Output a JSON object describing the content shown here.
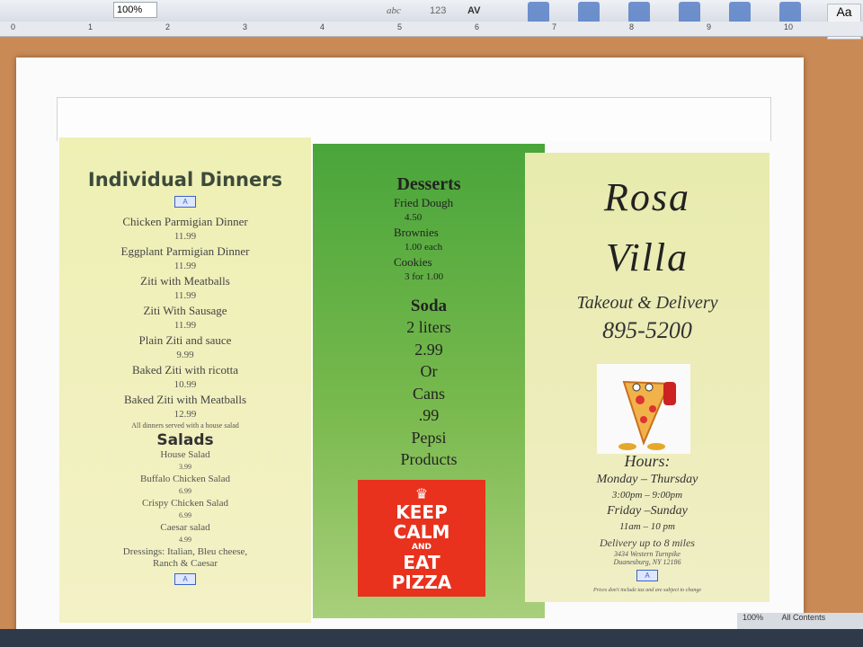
{
  "ribbon": {
    "zoom_value": "100%",
    "tools": [
      {
        "label": "Text Box",
        "icon": "text-box-icon"
      },
      {
        "label": "WordArt",
        "icon": "wordart-icon"
      },
      {
        "label": "Shape",
        "icon": "shape-icon"
      },
      {
        "label": "Picture",
        "icon": "picture-icon"
      },
      {
        "label": "Reorder",
        "icon": "reorder-icon"
      },
      {
        "label": "Group",
        "icon": "group-icon"
      }
    ],
    "theme_label": "Aa"
  },
  "ruler": {
    "ticks": [
      "0",
      "1",
      "2",
      "3",
      "4",
      "5",
      "6",
      "7",
      "8",
      "9",
      "10"
    ]
  },
  "left_panel": {
    "heading": "Individual Dinners",
    "dinners": [
      {
        "name": "Chicken Parmigian Dinner",
        "price": "11.99"
      },
      {
        "name": "Eggplant Parmigian Dinner",
        "price": "11.99"
      },
      {
        "name": "Ziti with Meatballs",
        "price": "11.99"
      },
      {
        "name": "Ziti With Sausage",
        "price": "11.99"
      },
      {
        "name": "Plain Ziti and sauce",
        "price": "9.99"
      },
      {
        "name": "Baked Ziti with ricotta",
        "price": "10.99"
      },
      {
        "name": "Baked Ziti with Meatballs",
        "price": "12.99"
      }
    ],
    "dinner_note": "All dinners served with a house salad",
    "salads_heading": "Salads",
    "salads": [
      {
        "name": "House Salad",
        "price": "3.99"
      },
      {
        "name": "Buffalo Chicken Salad",
        "price": "6.99"
      },
      {
        "name": "Crispy Chicken Salad",
        "price": "6.99"
      },
      {
        "name": "Caesar salad",
        "price": "4.99"
      }
    ],
    "dressings_line1": "Dressings: Italian, Bleu cheese,",
    "dressings_line2": "Ranch & Caesar"
  },
  "middle_panel": {
    "desserts_heading": "Desserts",
    "desserts": [
      {
        "name": "Fried Dough",
        "price": "4.50"
      },
      {
        "name": "Brownies",
        "price": "1.00 each"
      },
      {
        "name": "Cookies",
        "price": "3 for 1.00"
      }
    ],
    "soda_heading": "Soda",
    "soda_lines": [
      "2 liters",
      "2.99",
      "Or",
      "Cans",
      ".99",
      "Pepsi",
      "Products"
    ],
    "sign": {
      "line1": "KEEP",
      "line2": "CALM",
      "line3": "AND",
      "line4": "EAT",
      "line5": "PIZZA"
    }
  },
  "right_panel": {
    "name_line1": "Rosa",
    "name_line2": "Villa",
    "tagline": "Takeout & Delivery",
    "phone": "895-5200",
    "hours_heading": "Hours:",
    "hours_lines": [
      "Monday – Thursday",
      "3:00pm – 9:00pm",
      "Friday –Sunday",
      "11am – 10 pm"
    ],
    "delivery": "Delivery up to 8 miles",
    "address1": "3434 Western Turnpike",
    "address2": "Duanesburg, NY 12186",
    "footnote": "Prices don't include tax and are subject to change"
  },
  "status": {
    "zoom": "100%",
    "right_text": "All Contents"
  },
  "colors": {
    "keep_sign": "#e8321e",
    "mid_panel": "#5fae43",
    "side_panel": "#eef0b4"
  }
}
